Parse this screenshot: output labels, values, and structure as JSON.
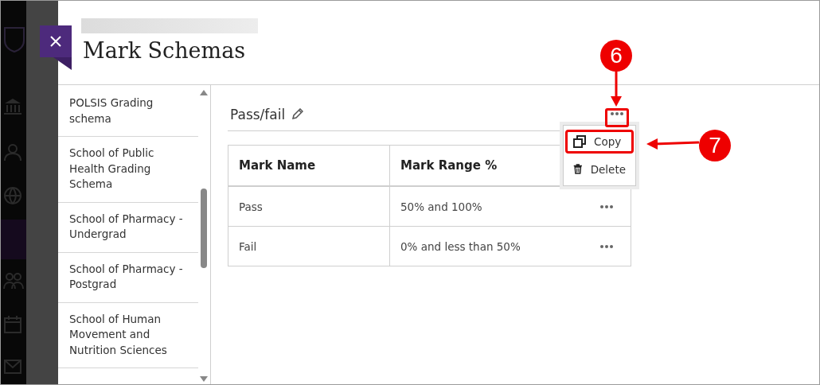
{
  "panel": {
    "title": "Mark Schemas"
  },
  "schemas": [
    {
      "label": "POLSIS Grading schema"
    },
    {
      "label": "School of Public Health Grading Schema"
    },
    {
      "label": "School of Pharmacy - Undergrad"
    },
    {
      "label": "School of Pharmacy - Postgrad"
    },
    {
      "label": "School of Human Movement and Nutrition Sciences"
    }
  ],
  "schema": {
    "title": "Pass/fail"
  },
  "table": {
    "columns": [
      "Mark Name",
      "Mark Range %"
    ],
    "rows": [
      {
        "name": "Pass",
        "range": "50% and 100%"
      },
      {
        "name": "Fail",
        "range": "0% and less than 50%"
      }
    ]
  },
  "menu": {
    "items": [
      {
        "label": "Copy",
        "kind": "copy",
        "highlighted": true
      },
      {
        "label": "Delete",
        "kind": "delete",
        "highlighted": false
      }
    ]
  },
  "callouts": [
    {
      "label": "6"
    },
    {
      "label": "7"
    }
  ]
}
